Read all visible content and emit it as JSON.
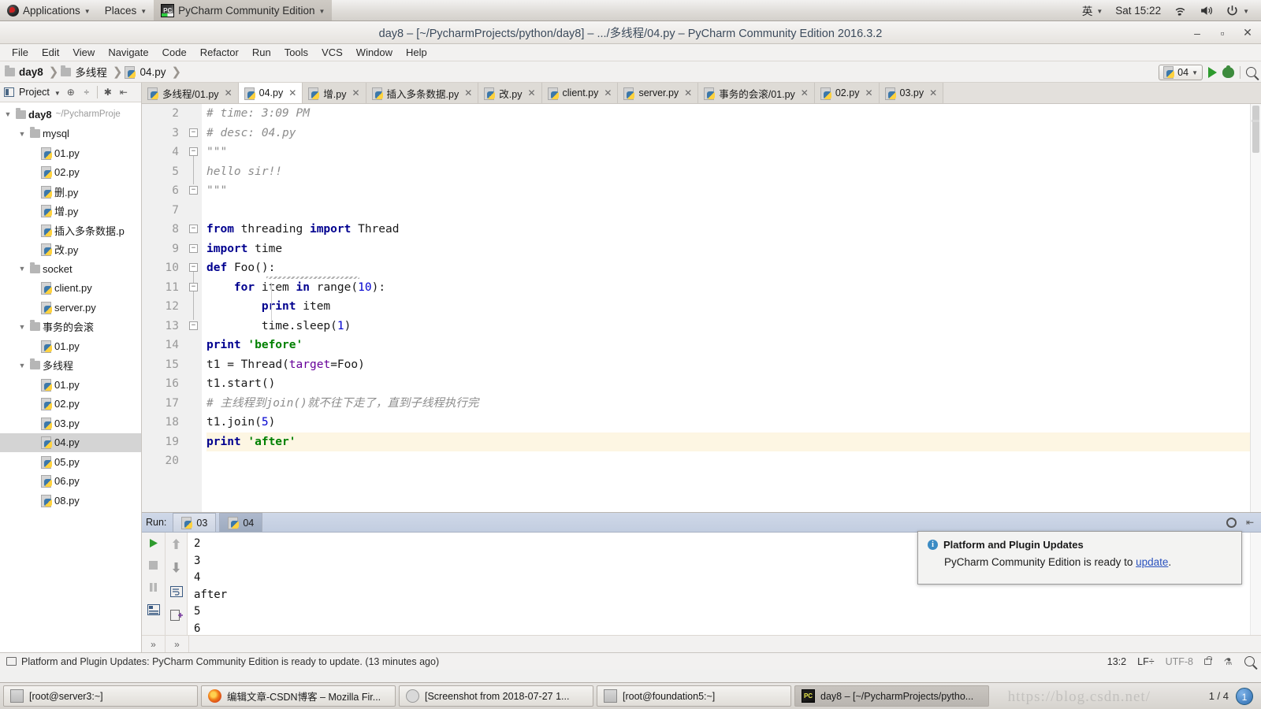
{
  "gnome": {
    "applications": "Applications",
    "places": "Places",
    "app_name": "PyCharm Community Edition",
    "input_method": "英",
    "clock": "Sat 15:22"
  },
  "window": {
    "title": "day8 – [~/PycharmProjects/python/day8] – .../多线程/04.py – PyCharm Community Edition 2016.3.2",
    "minimize": "–",
    "maximize": "▫",
    "close": "✕"
  },
  "menubar": [
    {
      "label": "File"
    },
    {
      "label": "Edit"
    },
    {
      "label": "View"
    },
    {
      "label": "Navigate"
    },
    {
      "label": "Code"
    },
    {
      "label": "Refactor"
    },
    {
      "label": "Run"
    },
    {
      "label": "Tools"
    },
    {
      "label": "VCS"
    },
    {
      "label": "Window"
    },
    {
      "label": "Help"
    }
  ],
  "breadcrumb": [
    {
      "label": "day8",
      "icon": "folder-icon"
    },
    {
      "label": "多线程",
      "icon": "folder-icon"
    },
    {
      "label": "04.py",
      "icon": "python-file-icon"
    }
  ],
  "toolbar": {
    "run_config": "04",
    "run_tooltip": "Run",
    "debug_tooltip": "Debug",
    "search_tooltip": "Search Everywhere"
  },
  "project_panel": {
    "title": "Project",
    "root": {
      "label": "day8",
      "path": "~/PycharmProje"
    },
    "tree": [
      {
        "label": "day8",
        "path": "~/PycharmProje",
        "depth": 0,
        "type": "root",
        "expanded": true,
        "selected": false
      },
      {
        "label": "mysql",
        "depth": 1,
        "type": "folder",
        "expanded": true,
        "selected": false
      },
      {
        "label": "01.py",
        "depth": 2,
        "type": "py",
        "selected": false
      },
      {
        "label": "02.py",
        "depth": 2,
        "type": "py",
        "selected": false
      },
      {
        "label": "删.py",
        "depth": 2,
        "type": "py",
        "selected": false
      },
      {
        "label": "增.py",
        "depth": 2,
        "type": "py",
        "selected": false
      },
      {
        "label": "插入多条数据.p",
        "depth": 2,
        "type": "py",
        "selected": false
      },
      {
        "label": "改.py",
        "depth": 2,
        "type": "py",
        "selected": false
      },
      {
        "label": "socket",
        "depth": 1,
        "type": "folder",
        "expanded": true,
        "selected": false
      },
      {
        "label": "client.py",
        "depth": 2,
        "type": "py",
        "selected": false
      },
      {
        "label": "server.py",
        "depth": 2,
        "type": "py",
        "selected": false
      },
      {
        "label": "事务的会滚",
        "depth": 1,
        "type": "folder",
        "expanded": true,
        "selected": false
      },
      {
        "label": "01.py",
        "depth": 2,
        "type": "py",
        "selected": false
      },
      {
        "label": "多线程",
        "depth": 1,
        "type": "folder",
        "expanded": true,
        "selected": false
      },
      {
        "label": "01.py",
        "depth": 2,
        "type": "py",
        "selected": false
      },
      {
        "label": "02.py",
        "depth": 2,
        "type": "py",
        "selected": false
      },
      {
        "label": "03.py",
        "depth": 2,
        "type": "py",
        "selected": false
      },
      {
        "label": "04.py",
        "depth": 2,
        "type": "py",
        "selected": true
      },
      {
        "label": "05.py",
        "depth": 2,
        "type": "py",
        "selected": false
      },
      {
        "label": "06.py",
        "depth": 2,
        "type": "py",
        "selected": false
      },
      {
        "label": "08.py",
        "depth": 2,
        "type": "py",
        "selected": false
      }
    ]
  },
  "editor_tabs": [
    {
      "label": "多线程/01.py",
      "active": false
    },
    {
      "label": "04.py",
      "active": true
    },
    {
      "label": "增.py",
      "active": false
    },
    {
      "label": "插入多条数据.py",
      "active": false
    },
    {
      "label": "改.py",
      "active": false
    },
    {
      "label": "client.py",
      "active": false
    },
    {
      "label": "server.py",
      "active": false
    },
    {
      "label": "事务的会滚/01.py",
      "active": false
    },
    {
      "label": "02.py",
      "active": false
    },
    {
      "label": "03.py",
      "active": false
    }
  ],
  "code": {
    "first_line_number": 2,
    "highlight_line": 19,
    "lines": [
      {
        "no": 2,
        "text": "# time: 3:09 PM",
        "style": "comment"
      },
      {
        "no": 3,
        "text": "# desc: 04.py",
        "style": "comment"
      },
      {
        "no": 4,
        "text": "\"\"\"",
        "style": "comment"
      },
      {
        "no": 5,
        "text": "hello sir!!",
        "style": "comment"
      },
      {
        "no": 6,
        "text": "\"\"\"",
        "style": "comment"
      },
      {
        "no": 7,
        "text": "",
        "style": "plain"
      },
      {
        "no": 8,
        "text": "from threading import Thread",
        "style": "code"
      },
      {
        "no": 9,
        "text": "import time",
        "style": "code"
      },
      {
        "no": 10,
        "text": "def Foo():",
        "style": "code"
      },
      {
        "no": 11,
        "text": "    for item in range(10):",
        "style": "code"
      },
      {
        "no": 12,
        "text": "        print item",
        "style": "code"
      },
      {
        "no": 13,
        "text": "        time.sleep(1)",
        "style": "code"
      },
      {
        "no": 14,
        "text": "print 'before'",
        "style": "code"
      },
      {
        "no": 15,
        "text": "t1 = Thread(target=Foo)",
        "style": "code"
      },
      {
        "no": 16,
        "text": "t1.start()",
        "style": "code"
      },
      {
        "no": 17,
        "text": "# 主线程到join()就不往下走了，直到子线程执行完",
        "style": "comment"
      },
      {
        "no": 18,
        "text": "t1.join(5)",
        "style": "code"
      },
      {
        "no": 19,
        "text": "print 'after'",
        "style": "code"
      },
      {
        "no": 20,
        "text": "",
        "style": "plain"
      }
    ]
  },
  "run_panel": {
    "label": "Run:",
    "tabs": [
      {
        "label": "03",
        "active": false
      },
      {
        "label": "04",
        "active": true
      }
    ],
    "console_lines": [
      "2",
      "3",
      "4",
      "after",
      "5",
      "6"
    ],
    "footer_buttons": [
      "»",
      "»"
    ]
  },
  "notification": {
    "title": "Platform and Plugin Updates",
    "message_before": "PyCharm Community Edition is ready to ",
    "link": "update",
    "message_after": "."
  },
  "statusbar": {
    "message": "Platform and Plugin Updates: PyCharm Community Edition is ready to update. (13 minutes ago)",
    "caret": "13:2",
    "line_sep": "LF÷",
    "encoding": "UTF-8"
  },
  "taskbar": {
    "items": [
      {
        "label": "[root@server3:~]",
        "icon": "terminal-icon",
        "active": false
      },
      {
        "label": "编辑文章-CSDN博客 – Mozilla Fir...",
        "icon": "firefox-icon",
        "active": false
      },
      {
        "label": "[Screenshot from 2018-07-27 1...",
        "icon": "image-viewer-icon",
        "active": false
      },
      {
        "label": "[root@foundation5:~]",
        "icon": "terminal-icon",
        "active": false
      },
      {
        "label": "day8 – [~/PycharmProjects/pytho...",
        "icon": "pycharm-icon",
        "active": true
      }
    ],
    "pager": "1 / 4",
    "badge": "1",
    "watermark": "https://blog.csdn.net/"
  },
  "colors": {
    "accent_blue": "#2a52be",
    "keyword": "#00008f",
    "string": "#008000",
    "comment": "#8c8c8c",
    "number": "#0000d0",
    "highlight_row": "#fdf6e3"
  }
}
